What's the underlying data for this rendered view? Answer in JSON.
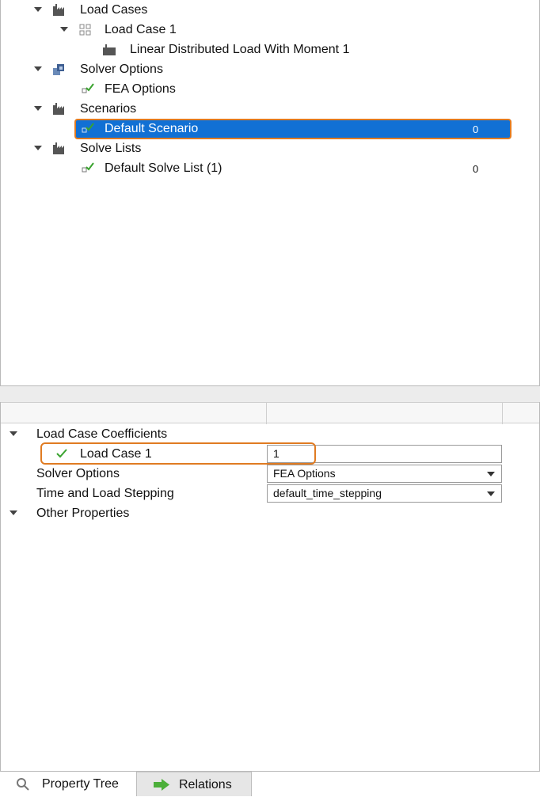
{
  "tree": {
    "items": [
      {
        "label": "Load Cases",
        "count": ""
      },
      {
        "label": "Load Case 1",
        "count": ""
      },
      {
        "label": "Linear Distributed Load With Moment 1",
        "count": ""
      },
      {
        "label": "Solver Options",
        "count": ""
      },
      {
        "label": "FEA Options",
        "count": ""
      },
      {
        "label": "Scenarios",
        "count": ""
      },
      {
        "label": "Default Scenario",
        "count": "0"
      },
      {
        "label": "Solve Lists",
        "count": ""
      },
      {
        "label": "Default Solve List (1)",
        "count": "0"
      }
    ],
    "selected_index": 6
  },
  "properties": {
    "groups": [
      {
        "label": "Load Case Coefficients"
      },
      {
        "label": "Other Properties"
      }
    ],
    "rows": [
      {
        "label": "Load Case 1",
        "value": "1"
      },
      {
        "label": "Solver Options",
        "value": "FEA Options"
      },
      {
        "label": "Time and Load Stepping",
        "value": "default_time_stepping"
      }
    ]
  },
  "tabs": [
    {
      "label": "Property Tree"
    },
    {
      "label": "Relations"
    }
  ],
  "colors": {
    "selection": "#1170d4",
    "highlight_outline": "#e07b22",
    "check_green": "#3aa32f"
  }
}
